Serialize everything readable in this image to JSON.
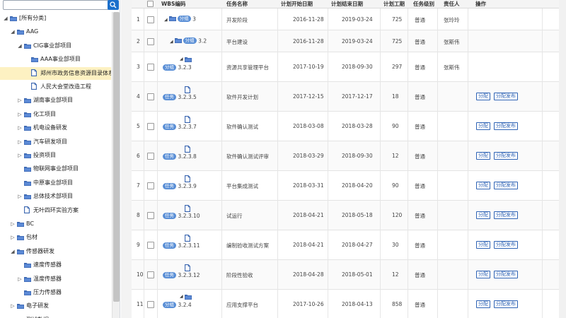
{
  "search": {
    "placeholder": "",
    "button_icon": "search-icon"
  },
  "tree": {
    "nodes": [
      {
        "label": "[所有分类]",
        "level": 0,
        "expanded": true,
        "type": "folder"
      },
      {
        "label": "AAG",
        "level": 1,
        "expanded": true,
        "type": "folder"
      },
      {
        "label": "CIG事业部项目",
        "level": 2,
        "expanded": true,
        "type": "folder"
      },
      {
        "label": "AAA事业部项目",
        "level": 3,
        "expanded": null,
        "type": "folder"
      },
      {
        "label": "郑州市政务信息资源目录体系",
        "level": 3,
        "expanded": null,
        "type": "file",
        "selected": true
      },
      {
        "label": "人民大会堂改造工程",
        "level": 3,
        "expanded": null,
        "type": "file"
      },
      {
        "label": "湖南事业部项目",
        "level": 2,
        "expanded": false,
        "type": "folder"
      },
      {
        "label": "化工项目",
        "level": 2,
        "expanded": false,
        "type": "folder"
      },
      {
        "label": "机电设备研发",
        "level": 2,
        "expanded": false,
        "type": "folder"
      },
      {
        "label": "汽车研发项目",
        "level": 2,
        "expanded": false,
        "type": "folder"
      },
      {
        "label": "投资项目",
        "level": 2,
        "expanded": false,
        "type": "folder"
      },
      {
        "label": "物联网事业部项目",
        "level": 2,
        "expanded": null,
        "type": "folder"
      },
      {
        "label": "中原事业部项目",
        "level": 2,
        "expanded": null,
        "type": "folder"
      },
      {
        "label": "总体技术部项目",
        "level": 2,
        "expanded": false,
        "type": "folder"
      },
      {
        "label": "无叶四环实验方案",
        "level": 2,
        "expanded": null,
        "type": "file"
      },
      {
        "label": "BC",
        "level": 1,
        "expanded": false,
        "type": "folder"
      },
      {
        "label": "包材",
        "level": 1,
        "expanded": false,
        "type": "folder"
      },
      {
        "label": "传感器研发",
        "level": 1,
        "expanded": true,
        "type": "folder"
      },
      {
        "label": "速度传感器",
        "level": 2,
        "expanded": null,
        "type": "folder"
      },
      {
        "label": "温度传感器",
        "level": 2,
        "expanded": false,
        "type": "folder"
      },
      {
        "label": "压力传感器",
        "level": 2,
        "expanded": null,
        "type": "folder"
      },
      {
        "label": "电子研发",
        "level": 1,
        "expanded": false,
        "type": "folder"
      },
      {
        "label": "测试数据",
        "level": 1,
        "expanded": false,
        "type": "folder"
      }
    ]
  },
  "table": {
    "headers": {
      "index": "",
      "check": "",
      "wbs": "WBS编码",
      "name": "任务名称",
      "plan_start": "计划开始日期",
      "plan_end": "计划结束日期",
      "duration": "计划工期",
      "task_type": "任务级别",
      "owner": "责任人",
      "action": "操作"
    },
    "assign_label": "分配",
    "assign_publish_label": "分配发布",
    "rows": [
      {
        "index": "1",
        "badge": "分组",
        "icon": "folder",
        "code": "3",
        "depth": 1,
        "name": "开发阶段",
        "start": "2016-11-28",
        "end": "2019-03-24",
        "duration": "725",
        "level": "普通",
        "owner": "张玲玲",
        "actions": false
      },
      {
        "index": "2",
        "badge": "分组",
        "icon": "folder",
        "code": "3.2",
        "depth": 2,
        "name": "平台建设",
        "start": "2016-11-28",
        "end": "2019-03-24",
        "duration": "725",
        "level": "普通",
        "owner": "张斯伟",
        "actions": false
      },
      {
        "index": "3",
        "badge": "分组",
        "icon": "folder",
        "code": "3.2.3",
        "depth": 3,
        "name": "资源共享管理平台",
        "start": "2017-10-19",
        "end": "2018-09-30",
        "duration": "297",
        "level": "普通",
        "owner": "张斯伟",
        "actions": false
      },
      {
        "index": "4",
        "badge": "任务",
        "icon": "file",
        "code": "3.2.3.5",
        "depth": 4,
        "name": "软件开发计划",
        "start": "2017-12-15",
        "end": "2017-12-17",
        "duration": "18",
        "level": "普通",
        "owner": "",
        "actions": true
      },
      {
        "index": "5",
        "badge": "任务",
        "icon": "file",
        "code": "3.2.3.7",
        "depth": 4,
        "name": "软件确认测试",
        "start": "2018-03-08",
        "end": "2018-03-28",
        "duration": "90",
        "level": "普通",
        "owner": "",
        "actions": true
      },
      {
        "index": "6",
        "badge": "任务",
        "icon": "file",
        "code": "3.2.3.8",
        "depth": 4,
        "name": "软件确认测试评审",
        "start": "2018-03-29",
        "end": "2018-09-30",
        "duration": "12",
        "level": "普通",
        "owner": "",
        "actions": true
      },
      {
        "index": "7",
        "badge": "任务",
        "icon": "file",
        "code": "3.2.3.9",
        "depth": 4,
        "name": "平台集成测试",
        "start": "2018-03-31",
        "end": "2018-04-20",
        "duration": "90",
        "level": "普通",
        "owner": "",
        "actions": true
      },
      {
        "index": "8",
        "badge": "任务",
        "icon": "file",
        "code": "3.2.3.10",
        "depth": 4,
        "name": "试运行",
        "start": "2018-04-21",
        "end": "2018-05-18",
        "duration": "120",
        "level": "普通",
        "owner": "",
        "actions": true
      },
      {
        "index": "9",
        "badge": "任务",
        "icon": "file",
        "code": "3.2.3.11",
        "depth": 4,
        "name": "编制验收测试方案",
        "start": "2018-04-21",
        "end": "2018-04-27",
        "duration": "30",
        "level": "普通",
        "owner": "",
        "actions": true
      },
      {
        "index": "10",
        "badge": "任务",
        "icon": "file",
        "code": "3.2.3.12",
        "depth": 4,
        "name": "阶段性验收",
        "start": "2018-04-28",
        "end": "2018-05-01",
        "duration": "12",
        "level": "普通",
        "owner": "",
        "actions": true
      },
      {
        "index": "11",
        "badge": "分组",
        "icon": "folder",
        "code": "3.2.4",
        "depth": 3,
        "name": "应用支撑平台",
        "start": "2017-10-26",
        "end": "2018-04-13",
        "duration": "858",
        "level": "普通",
        "owner": "",
        "actions": true
      }
    ]
  }
}
